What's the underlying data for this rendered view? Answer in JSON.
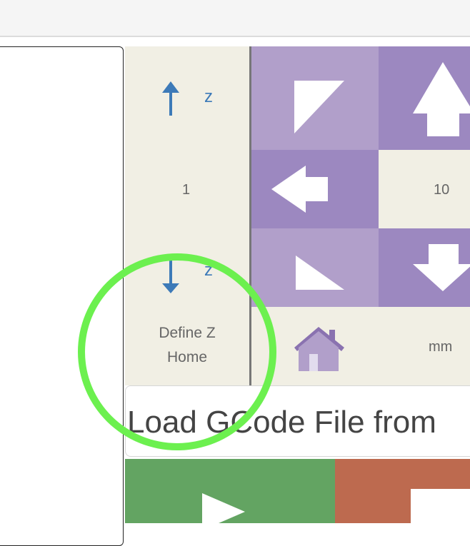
{
  "z_controls": {
    "up_axis_label": "z",
    "step_value": "1",
    "down_axis_label": "z",
    "define_home_line1": "Define Z",
    "define_home_line2": "Home"
  },
  "jog_pad": {
    "step_value": "10",
    "unit_label": "mm"
  },
  "actions": {
    "load_gcode_label": "Load GCode File from"
  },
  "colors": {
    "jog_light": "#b19fca",
    "jog_dark": "#9c88c0",
    "panel_bg": "#f1efe4",
    "axis_accent": "#3d7ab8",
    "run_green": "#63a462",
    "stop_red": "#bd6a4f",
    "annotation_circle": "#6cf04f"
  },
  "icons": [
    "arrow-up-icon",
    "arrow-down-icon",
    "triangle-up-left-icon",
    "arrow-left-icon",
    "triangle-down-left-icon",
    "home-icon",
    "play-icon",
    "stop-icon"
  ]
}
